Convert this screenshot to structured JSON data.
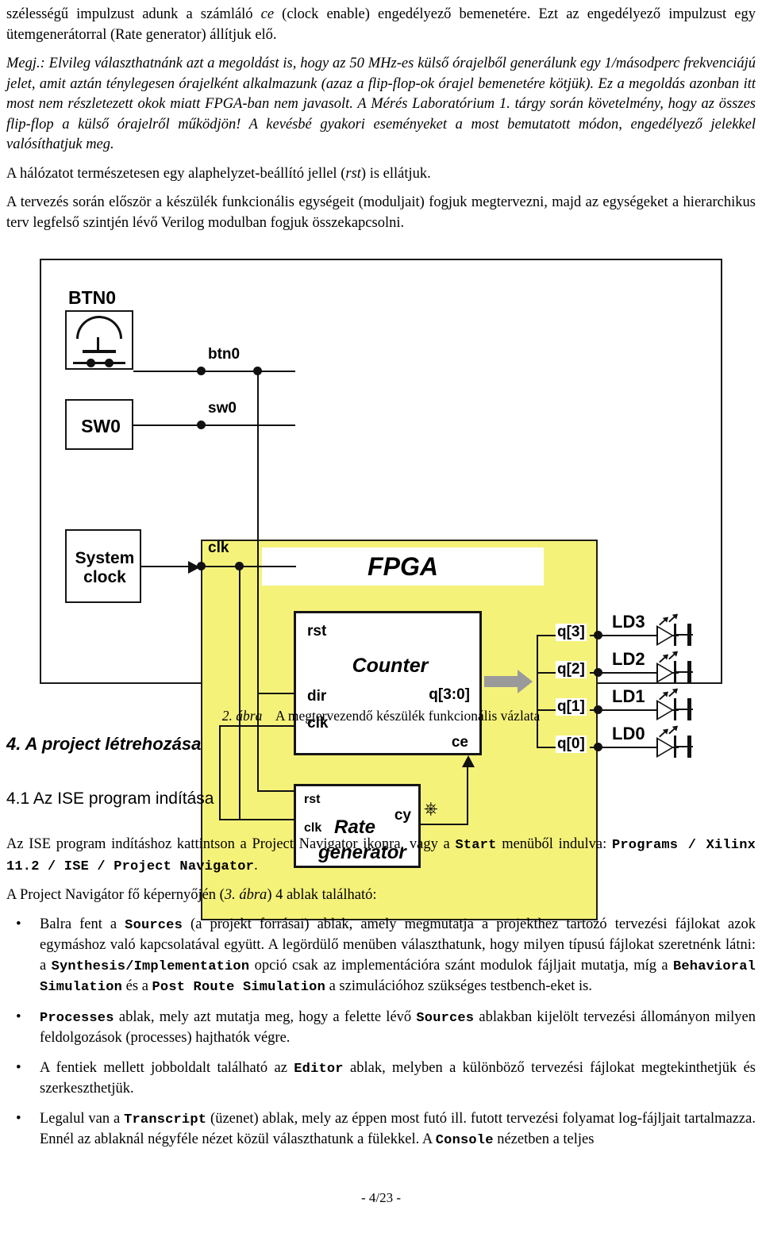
{
  "document": {
    "paragraphs": [
      "szélességű impulzust adunk a számláló ce (clock enable) engedélyező bemenetére. Ezt az engedélyező impulzust egy ütemgenerátorral (Rate generator) állítjuk elő.",
      "Megj.: Elvileg választhatnánk azt a megoldást is, hogy az 50 MHz-es külső órajelből generálunk egy 1/másodperc frekvenciájú jelet, amit aztán ténylegesen órajelként alkalmazunk (azaz a flip-flop-ok órajel bemenetére kötjük). Ez a megoldás azonban itt most nem részletezett okok miatt FPGA-ban nem javasolt. A Mérés Laboratórium 1. tárgy során követelmény, hogy az összes flip-flop a külső órajelről működjön! A kevésbé gyakori eseményeket a most bemutatott módon, engedélyező jelekkel valósíthatjuk meg.",
      "A hálózatot természetesen egy alaphelyzet-beállító jellel (rst) is ellátjuk.",
      "A tervezés során először a készülék funkcionális egységeit (moduljait) fogjuk megtervezni, majd az egységeket a hierarchikus terv legfelső szintjén lévő Verilog modulban fogjuk összekapcsolni."
    ],
    "para1_parts": {
      "a": "szélességű impulzust adunk a számláló ",
      "ce": "ce",
      "b": " (clock enable) engedélyező bemenetére. Ezt az engedélyező impulzust egy ütemgenerátorral (Rate generator) állítjuk elő."
    },
    "para_rst_parts": {
      "a": "A hálózatot természetesen egy alaphelyzet-beállító jellel (",
      "rst": "rst",
      "b": ") is ellátjuk."
    },
    "note_label": "Megj.:",
    "figure_caption": {
      "number": "2. ábra",
      "text": "A megtervezendő készülék funkcionális vázlata"
    },
    "section": "4.  A project létrehozása",
    "subsection": "4.1  Az ISE program indítása",
    "para_ise": {
      "a": "Az ISE program indításhoz kattintson a Project Navigator ikonra, vagy a ",
      "start": "Start",
      "b": " menüből indulva: ",
      "path": "Programs / Xilinx 11.2 / ISE / Project Navigator",
      "c": "."
    },
    "para_nav": {
      "a": "A Project Navigátor fő képernyőjén (",
      "ref": "3. ábra",
      "b": ") 4 ablak található:"
    },
    "bullets": [
      {
        "a": "Balra fent a ",
        "m1": "Sources",
        "b": " (a projekt forrásai) ablak, amely megmutatja a projekthez tartozó tervezési fájlokat azok egymáshoz való kapcsolatával együtt. A legördülő menüben választhatunk, hogy milyen típusú fájlokat szeretnénk látni: a ",
        "m2": "Synthesis/Implementation",
        "c": " opció csak az implementációra szánt modulok fájljait mutatja, míg a ",
        "m3": "Behavioral Simulation",
        "d": " és a ",
        "m4": "Post Route Simulation",
        "e": " a szimulációhoz szükséges testbench-eket is."
      },
      {
        "m1": "Processes",
        "a": " ablak, mely azt mutatja meg, hogy a felette lévő ",
        "m2": "Sources",
        "b": " ablakban kijelölt tervezési állományon milyen feldolgozások (processes) hajthatók végre."
      },
      {
        "a": "A fentiek mellett jobboldalt található az ",
        "m1": "Editor",
        "b": " ablak, melyben a különböző tervezési fájlokat megtekinthetjük és szerkeszthetjük."
      },
      {
        "a": "Legalul van a ",
        "m1": "Transcript",
        "b": " (üzenet) ablak, mely az éppen most futó ill. futott tervezési folyamat log-fájljait tartalmazza. Ennél az ablaknál négyféle nézet közül választhatunk a fülekkel. A ",
        "m2": "Console",
        "c": " nézetben a teljes"
      }
    ],
    "page_footer": "- 4/23 -"
  },
  "figure": {
    "title": "FPGA",
    "colors": {
      "fpga_fill": "#f5f27a",
      "line": "#111111",
      "bus_arrow": "#9a9a9a"
    },
    "external": {
      "btn_label": "BTN0",
      "sw_label": "SW0",
      "clock_label_line1": "System",
      "clock_label_line2": "clock"
    },
    "nets": {
      "btn0": "btn0",
      "sw0": "sw0",
      "clk": "clk"
    },
    "counter": {
      "name": "Counter",
      "inputs": [
        "rst",
        "dir",
        "clk"
      ],
      "enable": "ce",
      "output": "q[3:0]"
    },
    "rate_generator": {
      "name_line1": "Rate",
      "name_line2": "generator",
      "inputs": [
        "rst",
        "clk"
      ],
      "output": "cy"
    },
    "bus_bits": [
      "q[3]",
      "q[2]",
      "q[1]",
      "q[0]"
    ],
    "leds": [
      "LD3",
      "LD2",
      "LD1",
      "LD0"
    ]
  }
}
